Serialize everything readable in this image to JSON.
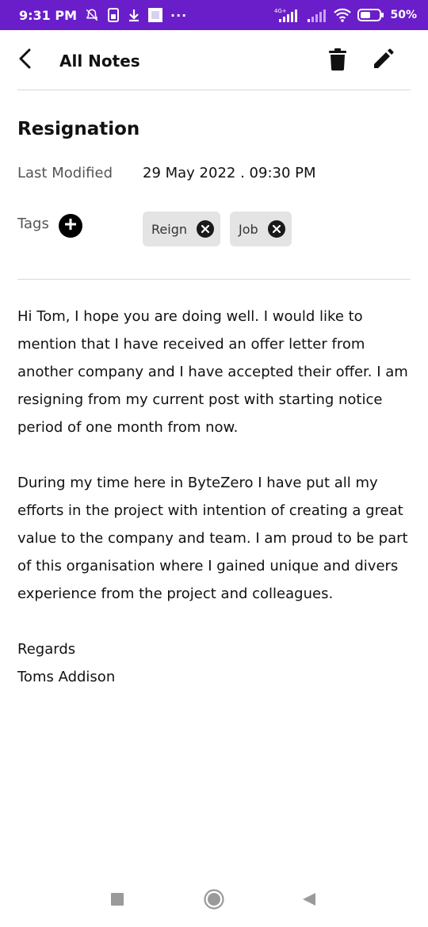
{
  "status_bar": {
    "time": "9:31 PM",
    "more": "···",
    "network": "4G+",
    "battery": "50%"
  },
  "header": {
    "title": "All Notes"
  },
  "note": {
    "title": "Resignation",
    "last_modified_label": "Last Modified",
    "last_modified_value": "29 May 2022 . 09:30 PM",
    "tags_label": "Tags",
    "tags": [
      "Reign",
      "Job"
    ],
    "body": [
      "Hi Tom, I hope you are doing well. I would like to mention that I have received an offer letter from another company and I have accepted their offer. I am resigning from my current post with starting notice period of one month from now.",
      "During my time here in ByteZero I have put all my efforts in the project with intention of creating a great value to the company and team. I am proud to be part of this organisation where I gained unique and divers experience from the project and colleagues.",
      "Regards"
    ],
    "signature": "Toms Addison"
  },
  "colors": {
    "status_bar": "#6a1ec9",
    "chip_bg": "#e4e4e4",
    "divider": "#d9d9d9"
  },
  "icons": {
    "back": "arrow-back-icon",
    "delete": "trash-icon",
    "edit": "pencil-icon",
    "add_tag": "plus-circle-icon",
    "remove_tag": "close-circle-icon",
    "nav_recents": "square-icon",
    "nav_home": "circle-icon",
    "nav_back": "triangle-icon"
  }
}
